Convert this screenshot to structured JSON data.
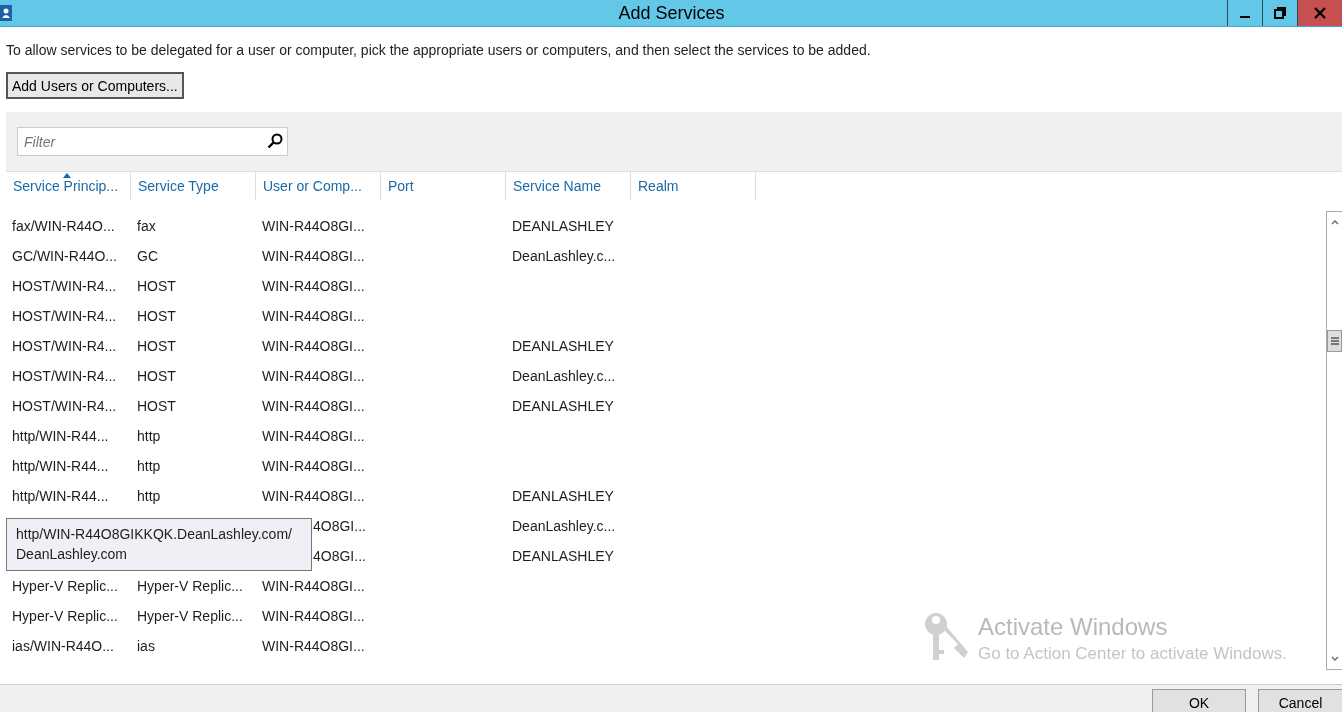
{
  "window": {
    "title": "Add Services"
  },
  "instruction": "To allow services to be delegated for a user or computer, pick the appropriate users or computers, and then select the services to be added.",
  "add_button": "Add Users or Computers...",
  "filter": {
    "placeholder": "Filter"
  },
  "table": {
    "columns": [
      {
        "label": "Service Princip...",
        "sorted": true
      },
      {
        "label": "Service Type",
        "sorted": false
      },
      {
        "label": "User or Comp...",
        "sorted": false
      },
      {
        "label": "Port",
        "sorted": false
      },
      {
        "label": "Service Name",
        "sorted": false
      },
      {
        "label": "Realm",
        "sorted": false
      }
    ],
    "rows": [
      {
        "spn": "fax/WIN-R44O...",
        "type": "fax",
        "user": "WIN-R44O8GI...",
        "service_name": "DEANLASHLEY"
      },
      {
        "spn": "GC/WIN-R44O...",
        "type": "GC",
        "user": "WIN-R44O8GI...",
        "service_name": "DeanLashley.c..."
      },
      {
        "spn": "HOST/WIN-R4...",
        "type": "HOST",
        "user": "WIN-R44O8GI..."
      },
      {
        "spn": "HOST/WIN-R4...",
        "type": "HOST",
        "user": "WIN-R44O8GI..."
      },
      {
        "spn": "HOST/WIN-R4...",
        "type": "HOST",
        "user": "WIN-R44O8GI...",
        "service_name": "DEANLASHLEY"
      },
      {
        "spn": "HOST/WIN-R4...",
        "type": "HOST",
        "user": "WIN-R44O8GI...",
        "service_name": "DeanLashley.c..."
      },
      {
        "spn": "HOST/WIN-R4...",
        "type": "HOST",
        "user": "WIN-R44O8GI...",
        "service_name": "DEANLASHLEY"
      },
      {
        "spn": "http/WIN-R44...",
        "type": "http",
        "user": "WIN-R44O8GI..."
      },
      {
        "spn": "http/WIN-R44...",
        "type": "http",
        "user": "WIN-R44O8GI..."
      },
      {
        "spn": "http/WIN-R44...",
        "type": "http",
        "user": "WIN-R44O8GI...",
        "service_name": "DEANLASHLEY"
      },
      {
        "user": "4O8GI...",
        "service_name": "DeanLashley.c..."
      },
      {
        "user": "4O8GI...",
        "service_name": "DEANLASHLEY"
      },
      {
        "spn": "Hyper-V Replic...",
        "type": "Hyper-V Replic...",
        "user": "WIN-R44O8GI..."
      },
      {
        "spn": "Hyper-V Replic...",
        "type": "Hyper-V Replic...",
        "user": "WIN-R44O8GI..."
      },
      {
        "spn": "ias/WIN-R44O...",
        "type": "ias",
        "user": "WIN-R44O8GI..."
      }
    ]
  },
  "tooltip": [
    "http/WIN-R44O8GIKKQK.DeanLashley.com/",
    "DeanLashley.com"
  ],
  "activation": {
    "title": "Activate Windows",
    "subtitle": "Go to Action Center to activate Windows."
  },
  "buttons": [
    "OK",
    "Cancel"
  ]
}
